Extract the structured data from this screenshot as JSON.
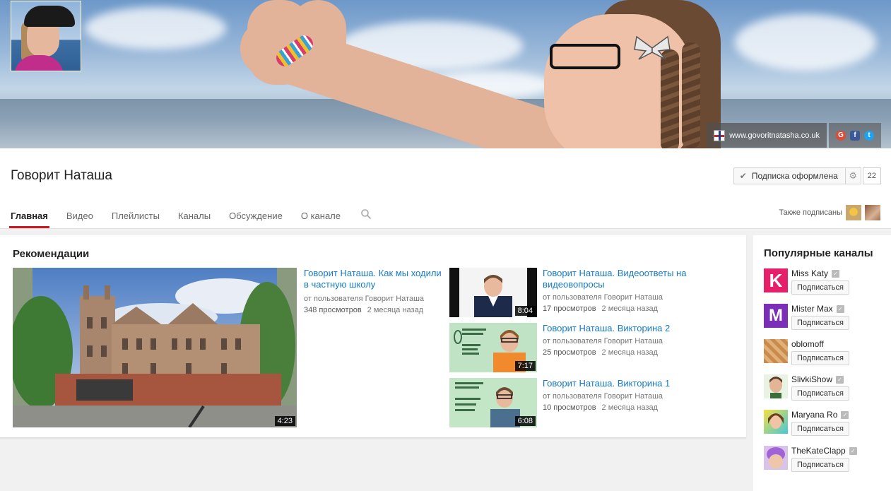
{
  "banner": {
    "website_label": "www.govoritnatasha.co.uk",
    "social_icons": [
      "google-plus-icon",
      "facebook-icon",
      "twitter-icon"
    ],
    "colors": {
      "google_plus": "#dd4b39",
      "facebook": "#3b5998",
      "twitter": "#1da1f2"
    }
  },
  "channel": {
    "title": "Говорит Наташа",
    "subscribe_label": "Подписка оформлена",
    "subscriber_count": "22"
  },
  "tabs": [
    {
      "label": "Главная",
      "active": true
    },
    {
      "label": "Видео",
      "active": false
    },
    {
      "label": "Плейлисты",
      "active": false
    },
    {
      "label": "Каналы",
      "active": false
    },
    {
      "label": "Обсуждение",
      "active": false
    },
    {
      "label": "О канале",
      "active": false
    }
  ],
  "also_subscribed_label": "Также подписаны",
  "recommendations": {
    "title": "Рекомендации",
    "featured": {
      "title": "Говорит Наташа. Как мы ходили в частную школу",
      "author": "от пользователя Говорит Наташа",
      "views": "348 просмотров",
      "age": "2 месяца назад",
      "duration": "4:23"
    },
    "videos": [
      {
        "title": "Говорит Наташа. Видеоответы на видеовопросы",
        "author": "от пользователя Говорит Наташа",
        "views": "17 просмотров",
        "age": "2 месяца назад",
        "duration": "8:04"
      },
      {
        "title": "Говорит Наташа. Викторина 2",
        "author": "от пользователя Говорит Наташа",
        "views": "25 просмотров",
        "age": "2 месяца назад",
        "duration": "7:17"
      },
      {
        "title": "Говорит Наташа. Викторина 1",
        "author": "от пользователя Говорит Наташа",
        "views": "10 просмотров",
        "age": "2 месяца назад",
        "duration": "6:08"
      }
    ]
  },
  "popular": {
    "title": "Популярные каналы",
    "subscribe_label": "Подписаться",
    "channels": [
      {
        "name": "Miss Katy"
      },
      {
        "name": "Mister Max"
      },
      {
        "name": "oblomoff"
      },
      {
        "name": "SlivkiShow"
      },
      {
        "name": "Maryana Ro"
      },
      {
        "name": "TheKateClapp"
      }
    ]
  }
}
